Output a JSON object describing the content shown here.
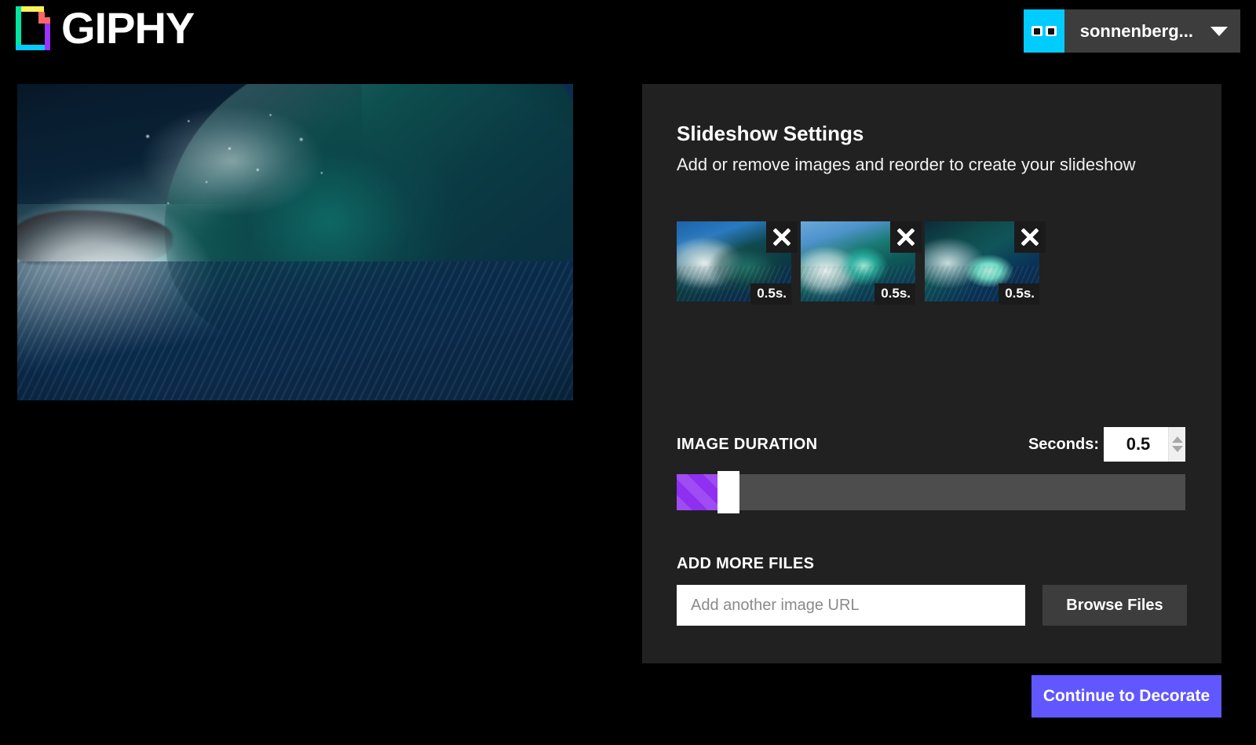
{
  "header": {
    "brand_name": "GIPHY",
    "logo_icon": "giphy-logo-icon",
    "account": {
      "avatar_icon": "giphy-eyes-avatar-icon",
      "username": "sonnenberg...",
      "caret_icon": "chevron-down-icon"
    }
  },
  "preview": {
    "alt": "Breaking ocean wave barrel preview"
  },
  "panel": {
    "title": "Slideshow Settings",
    "subtitle": "Add or remove images and reorder to create your slideshow",
    "thumbnails": [
      {
        "duration_label": "0.5s.",
        "remove_icon": "close-x-icon",
        "alt": "Wave thumbnail 1"
      },
      {
        "duration_label": "0.5s.",
        "remove_icon": "close-x-icon",
        "alt": "Wave thumbnail 2"
      },
      {
        "duration_label": "0.5s.",
        "remove_icon": "close-x-icon",
        "alt": "Wave thumbnail 3"
      }
    ],
    "duration": {
      "label": "IMAGE DURATION",
      "seconds_label": "Seconds:",
      "value": "0.5",
      "stepper_up_icon": "caret-up-icon",
      "stepper_down_icon": "caret-down-icon",
      "slider_fill_percent": 8,
      "slider_fill_color": "#8f2ff0",
      "slider_track_color": "#4d4d4d"
    },
    "add_files": {
      "label": "ADD MORE FILES",
      "url_placeholder": "Add another image URL",
      "url_value": "",
      "browse_label": "Browse Files"
    }
  },
  "footer": {
    "continue_label": "Continue to Decorate",
    "continue_color": "#6157ff"
  }
}
